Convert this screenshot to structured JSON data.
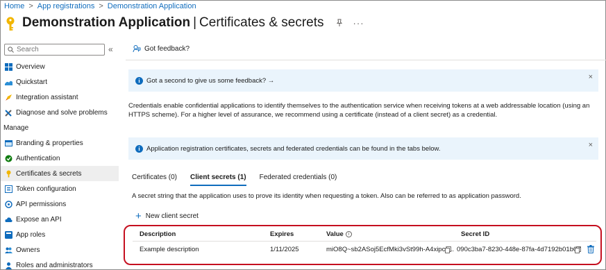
{
  "breadcrumb": {
    "home": "Home",
    "app_registrations": "App registrations",
    "application": "Demonstration Application",
    "separator": ">"
  },
  "header": {
    "app_name": "Demonstration Application",
    "separator": "|",
    "page_title": "Certificates & secrets",
    "pin_icon": "pin-icon",
    "more_icon": "ellipsis-icon",
    "more_glyph": "···"
  },
  "sidebar": {
    "search_placeholder": "Search",
    "collapse_glyph": "«",
    "items_top": [
      {
        "label": "Overview",
        "icon": "overview-icon"
      },
      {
        "label": "Quickstart",
        "icon": "quickstart-icon"
      },
      {
        "label": "Integration assistant",
        "icon": "rocket-icon"
      },
      {
        "label": "Diagnose and solve problems",
        "icon": "wrench-icon"
      }
    ],
    "section_manage": "Manage",
    "items_manage": [
      {
        "label": "Branding & properties",
        "icon": "branding-icon"
      },
      {
        "label": "Authentication",
        "icon": "authentication-icon"
      },
      {
        "label": "Certificates & secrets",
        "icon": "key-icon"
      },
      {
        "label": "Token configuration",
        "icon": "token-icon"
      },
      {
        "label": "API permissions",
        "icon": "api-permissions-icon"
      },
      {
        "label": "Expose an API",
        "icon": "cloud-icon"
      },
      {
        "label": "App roles",
        "icon": "app-roles-icon"
      },
      {
        "label": "Owners",
        "icon": "owners-icon"
      },
      {
        "label": "Roles and administrators",
        "icon": "admin-icon"
      }
    ],
    "active_label": "Certificates & secrets"
  },
  "feedback": {
    "label": "Got feedback?"
  },
  "banner_feedback": {
    "text": "Got a second to give us some feedback? →",
    "close": "×"
  },
  "description": "Credentials enable confidential applications to identify themselves to the authentication service when receiving tokens at a web addressable location (using an HTTPS scheme). For a higher level of assurance, we recommend using a certificate (instead of a client secret) as a credential.",
  "banner_info": {
    "text": "Application registration certificates, secrets and federated credentials can be found in the tabs below.",
    "close": "×"
  },
  "tabs": [
    {
      "label": "Certificates (0)",
      "active": false
    },
    {
      "label": "Client secrets (1)",
      "active": true
    },
    {
      "label": "Federated credentials (0)",
      "active": false
    }
  ],
  "tab_description": "A secret string that the application uses to prove its identity when requesting a token. Also can be referred to as application password.",
  "new_secret": {
    "plus": "+",
    "label": "New client secret"
  },
  "secrets_table": {
    "columns": [
      "Description",
      "Expires",
      "Value",
      "Secret ID"
    ],
    "info_glyph": "i",
    "rows": [
      {
        "description": "Example description",
        "expires": "1/11/2025",
        "value": "miO8Q~sb2ASoj5EcfMki3vSt99h-A4xipcj ...",
        "secret_id": "090c3ba7-8230-448e-87fa-4d7192b01b07"
      }
    ]
  },
  "colors": {
    "accent": "#0f6cbd",
    "highlight_frame": "#c50f1f",
    "banner_bg": "#eaf4fc",
    "active_nav_bg": "#eeeeee"
  }
}
